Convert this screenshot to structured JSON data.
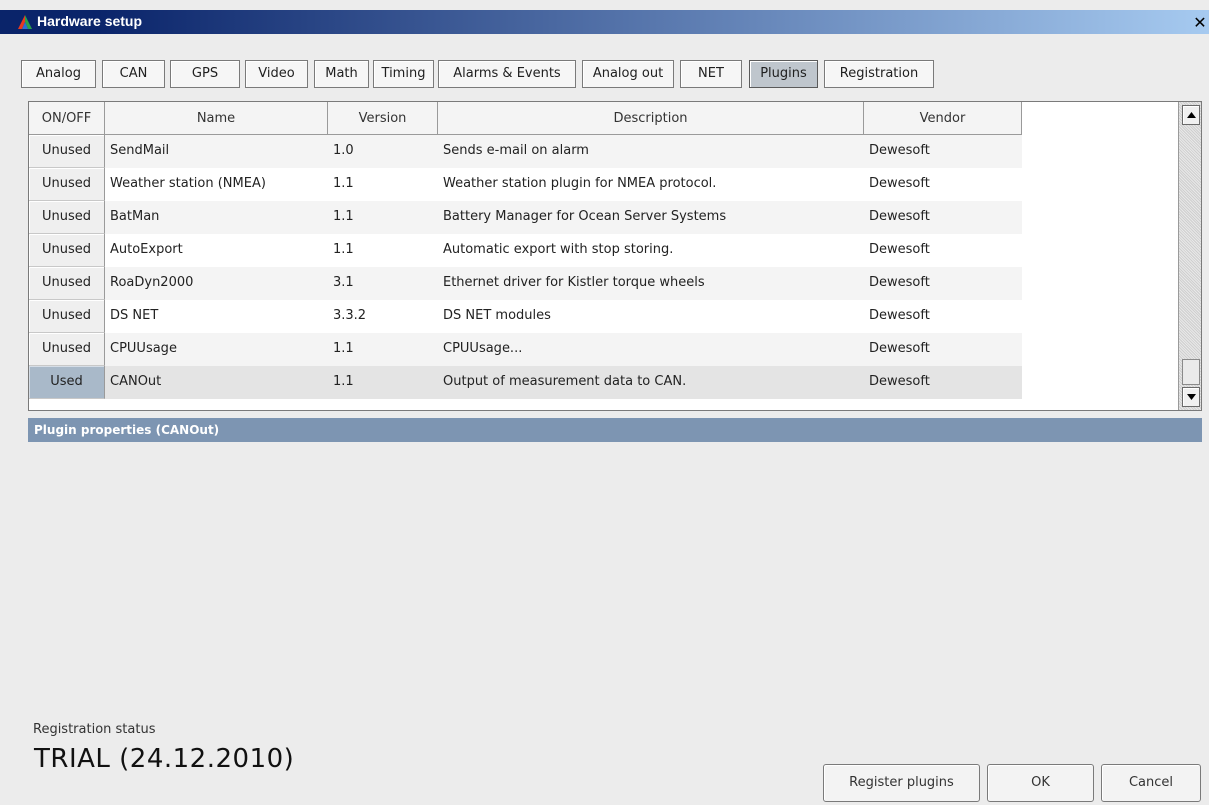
{
  "window": {
    "title": "Hardware setup",
    "close_glyph": "✕"
  },
  "tabs": [
    {
      "label": "Analog"
    },
    {
      "label": "CAN"
    },
    {
      "label": "GPS"
    },
    {
      "label": "Video"
    },
    {
      "label": "Math"
    },
    {
      "label": "Timing"
    },
    {
      "label": "Alarms & Events"
    },
    {
      "label": "Analog out"
    },
    {
      "label": "NET"
    },
    {
      "label": "Plugins"
    },
    {
      "label": "Registration"
    }
  ],
  "active_tab": "Plugins",
  "table": {
    "columns": [
      "ON/OFF",
      "Name",
      "Version",
      "Description",
      "Vendor"
    ],
    "rows": [
      {
        "state": "Unused",
        "name": "SendMail",
        "version": "1.0",
        "description": "Sends e-mail on alarm",
        "vendor": "Dewesoft"
      },
      {
        "state": "Unused",
        "name": "Weather station (NMEA)",
        "version": "1.1",
        "description": "Weather station plugin for NMEA protocol.",
        "vendor": "Dewesoft"
      },
      {
        "state": "Unused",
        "name": "BatMan",
        "version": "1.1",
        "description": "Battery Manager for Ocean Server Systems",
        "vendor": "Dewesoft"
      },
      {
        "state": "Unused",
        "name": "AutoExport",
        "version": "1.1",
        "description": "Automatic export with stop storing.",
        "vendor": "Dewesoft"
      },
      {
        "state": "Unused",
        "name": "RoaDyn2000",
        "version": "3.1",
        "description": "Ethernet driver for Kistler torque wheels",
        "vendor": "Dewesoft"
      },
      {
        "state": "Unused",
        "name": "DS NET",
        "version": "3.3.2",
        "description": "DS NET modules",
        "vendor": "Dewesoft"
      },
      {
        "state": "Unused",
        "name": "CPUUsage",
        "version": "1.1",
        "description": "CPUUsage...",
        "vendor": "Dewesoft"
      },
      {
        "state": "Used",
        "name": "CANOut",
        "version": "1.1",
        "description": "Output of measurement data to CAN.",
        "vendor": "Dewesoft"
      }
    ]
  },
  "properties": {
    "title": "Plugin properties (CANOut)"
  },
  "registration": {
    "label": "Registration status",
    "value": "TRIAL (24.12.2010)"
  },
  "buttons": {
    "register": "Register plugins",
    "ok": "OK",
    "cancel": "Cancel"
  },
  "colors": {
    "title_bar": "#0a246a",
    "selected_state": "#a9b9c9",
    "panel_header": "#7d95b2"
  }
}
